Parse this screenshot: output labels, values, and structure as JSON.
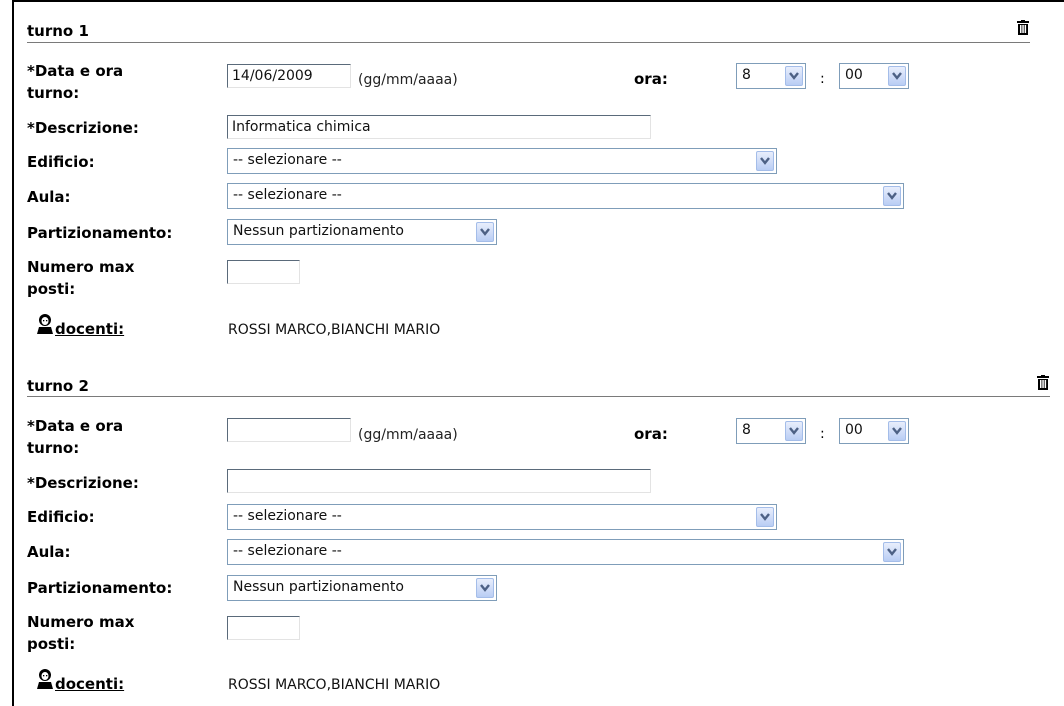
{
  "turni": [
    {
      "title": "turno 1",
      "data_label_1": "*Data e ora",
      "data_label_2": "turno:",
      "date_value": "14/06/2009",
      "date_hint": "(gg/mm/aaaa)",
      "ora_label": "ora:",
      "hour_value": "8",
      "colon": ":",
      "minute_value": "00",
      "descr_label": "*Descrizione:",
      "descr_value": "Informatica chimica",
      "edificio_label": "Edificio:",
      "edificio_value": "-- selezionare --",
      "aula_label": "Aula:",
      "aula_value": "-- selezionare --",
      "part_label": "Partizionamento:",
      "part_value": "Nessun partizionamento",
      "max_label_1": "Numero max",
      "max_label_2": "posti:",
      "max_value": "",
      "docenti_label": "docenti:",
      "docenti_value": "ROSSI MARCO,BIANCHI MARIO"
    },
    {
      "title": "turno 2",
      "data_label_1": "*Data e ora",
      "data_label_2": "turno:",
      "date_value": "",
      "date_hint": "(gg/mm/aaaa)",
      "ora_label": "ora:",
      "hour_value": "8",
      "colon": ":",
      "minute_value": "00",
      "descr_label": "*Descrizione:",
      "descr_value": "",
      "edificio_label": "Edificio:",
      "edificio_value": "-- selezionare --",
      "aula_label": "Aula:",
      "aula_value": "-- selezionare --",
      "part_label": "Partizionamento:",
      "part_value": "Nessun partizionamento",
      "max_label_1": "Numero max",
      "max_label_2": "posti:",
      "max_value": "",
      "docenti_label": "docenti:",
      "docenti_value": "ROSSI MARCO,BIANCHI MARIO"
    }
  ],
  "icons": {
    "trash": "trash-icon",
    "person": "teacher-icon",
    "dropdown": "chevron-down-icon"
  },
  "colors": {
    "select_border": "#7f9db9",
    "arrow_bg": "#b9cdf4",
    "arrow_glyph": "#4d6185"
  }
}
